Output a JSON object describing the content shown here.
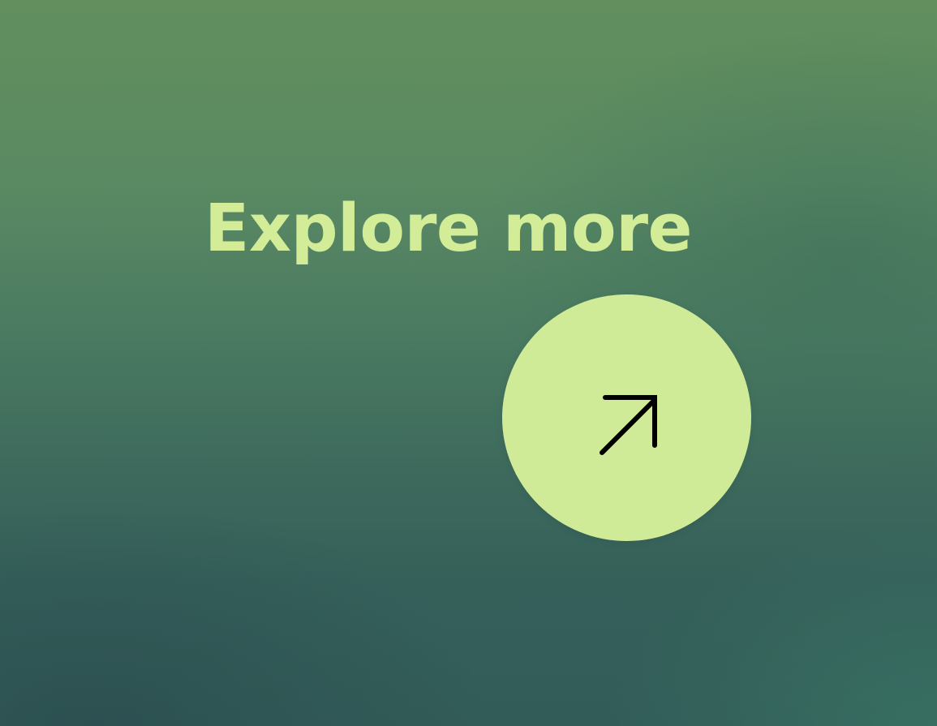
{
  "headline": "Explore more",
  "cta_button": {
    "icon": "arrow-up-right-icon",
    "color": "#d0eb98",
    "icon_color": "#000000"
  },
  "colors": {
    "headline": "#d2ec98",
    "background_top": "#628f5d",
    "background_bottom": "#325c58"
  }
}
